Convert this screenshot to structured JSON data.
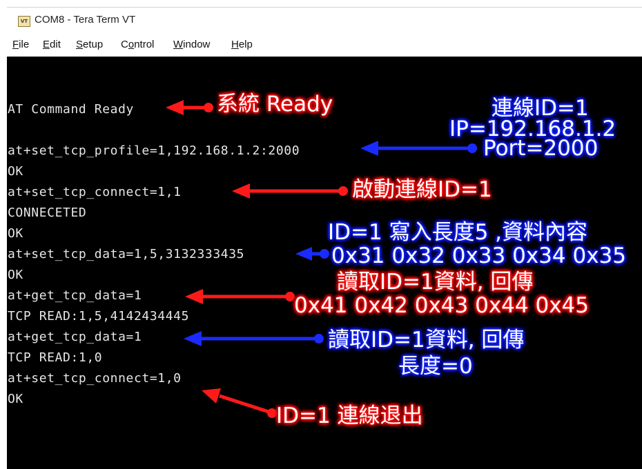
{
  "window": {
    "title": "COM8 - Tera Term VT",
    "icon_label": "VT"
  },
  "menu": [
    {
      "pre": "",
      "u": "F",
      "post": "ile"
    },
    {
      "pre": "",
      "u": "E",
      "post": "dit"
    },
    {
      "pre": "",
      "u": "S",
      "post": "etup"
    },
    {
      "pre": "C",
      "u": "o",
      "post": "ntrol"
    },
    {
      "pre": "",
      "u": "W",
      "post": "indow"
    },
    {
      "pre": "",
      "u": "H",
      "post": "elp"
    }
  ],
  "terminal": {
    "lines": [
      "AT Command Ready",
      "at+set_tcp_profile=1,192.168.1.2:2000",
      "OK",
      "at+set_tcp_connect=1,1",
      "CONNECETED",
      "OK",
      "at+set_tcp_data=1,5,3132333435",
      "OK",
      "at+get_tcp_data=1",
      "TCP READ:1,5,4142434445",
      "at+get_tcp_data=1",
      "TCP READ:1,0",
      "at+set_tcp_connect=1,0",
      "OK"
    ]
  },
  "annotations": {
    "system_ready": "系統 Ready",
    "conn_id": "連線ID=1",
    "ip": "IP=192.168.1.2",
    "port": "Port=2000",
    "start_conn": "啟動連線ID=1",
    "write_desc": "ID=1 寫入長度5 ,資料內容",
    "write_data": "0x31 0x32 0x33 0x34 0x35",
    "read_desc_1": "讀取ID=1資料, 回傳",
    "read_data_1": "0x41 0x42 0x43 0x44 0x45",
    "read_desc_2": "讀取ID=1資料, 回傳",
    "read_len_2": "長度=0",
    "disconnect": "ID=1 連線退出"
  },
  "colors": {
    "terminal_bg": "#000000",
    "terminal_text": "#e6e6e6",
    "annotation_red": "#ff1a1a",
    "annotation_blue": "#1a2bff"
  }
}
